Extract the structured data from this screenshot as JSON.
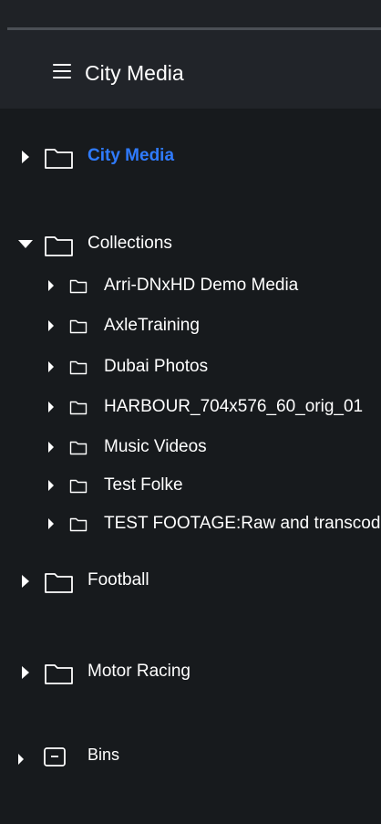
{
  "header": {
    "title": "City Media"
  },
  "tree": {
    "root": {
      "label": "City Media",
      "icon": "folder-icon",
      "state": "collapsed",
      "active": true
    },
    "collections": {
      "label": "Collections",
      "icon": "folder-icon",
      "state": "expanded",
      "children": [
        {
          "label": "Arri-DNxHD Demo Media"
        },
        {
          "label": "AxleTraining"
        },
        {
          "label": "Dubai Photos"
        },
        {
          "label": "HARBOUR_704x576_60_orig_01"
        },
        {
          "label": "Music Videos"
        },
        {
          "label": "Test Folke"
        },
        {
          "label": "TEST FOOTAGE:Raw and transcoded"
        }
      ]
    },
    "football": {
      "label": "Football",
      "icon": "folder-icon",
      "state": "collapsed"
    },
    "motor_racing": {
      "label": "Motor Racing",
      "icon": "folder-icon",
      "state": "collapsed"
    },
    "bins": {
      "label": "Bins",
      "icon": "bin-icon",
      "state": "collapsed"
    }
  },
  "colors": {
    "background": "#171a1d",
    "header": "#212429",
    "active": "#2f7bff",
    "text": "#ffffff"
  }
}
